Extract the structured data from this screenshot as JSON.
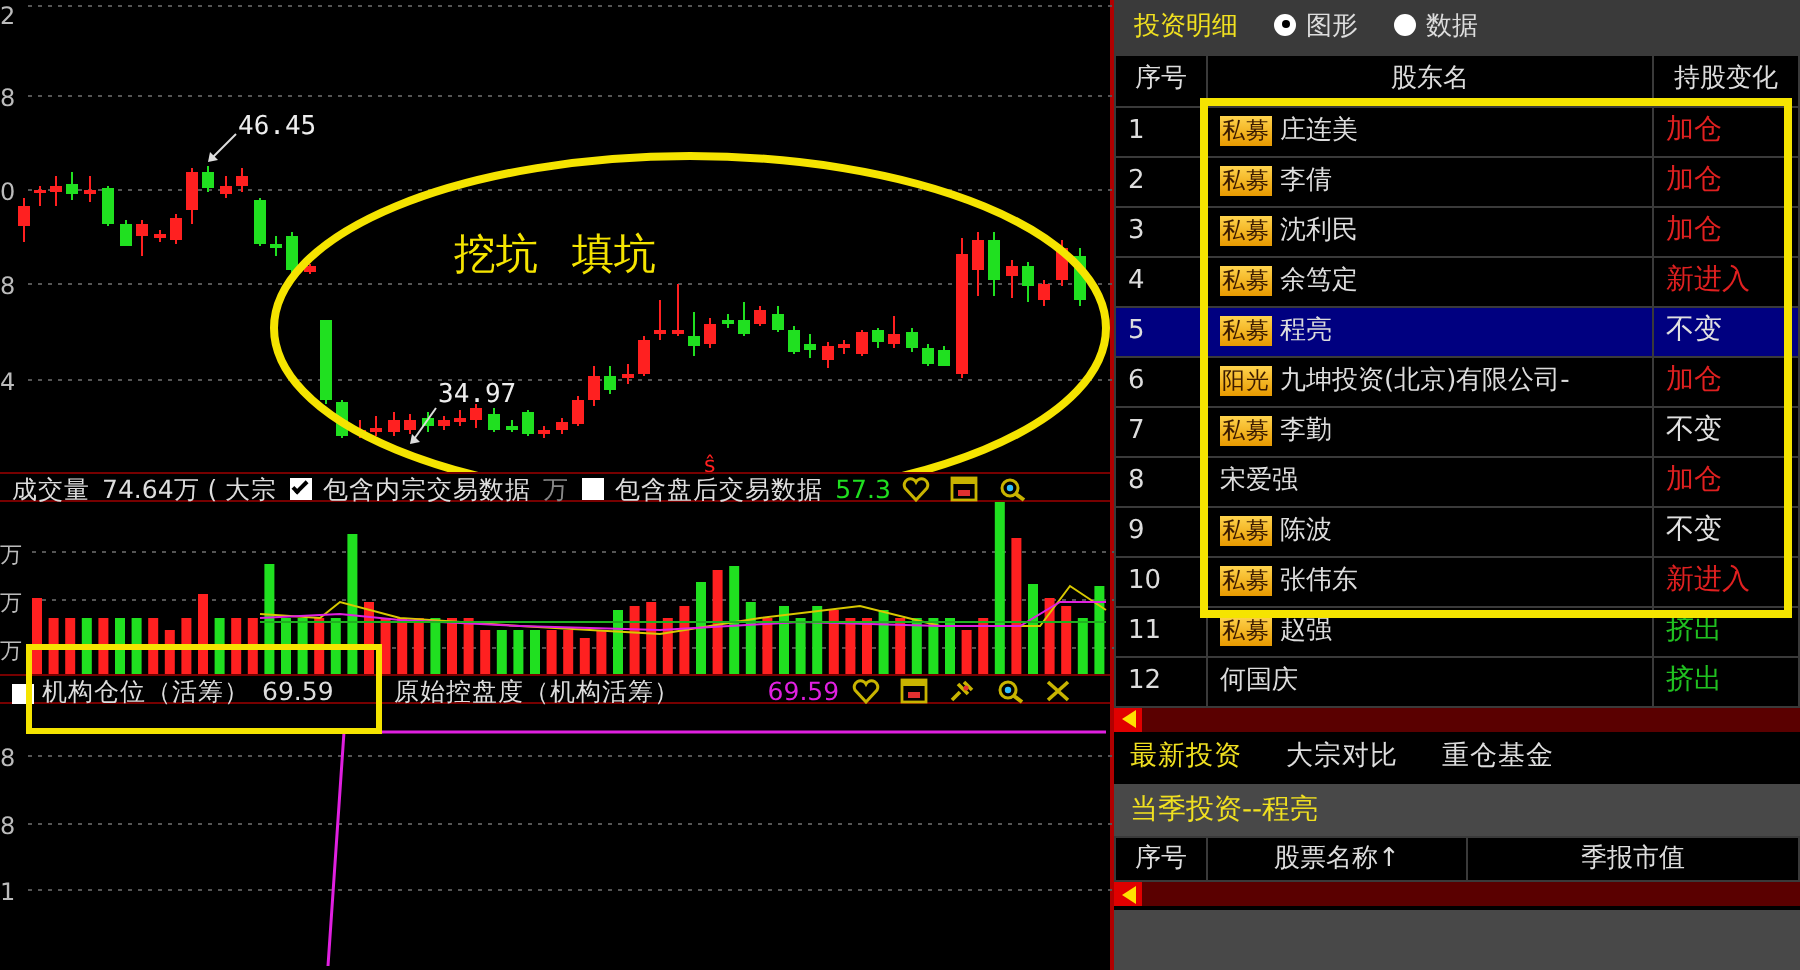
{
  "price_chart": {
    "axis_labels": [
      "2",
      "8",
      "0",
      "8",
      "4"
    ],
    "high_label": "46.45",
    "low_label": "34.97",
    "annotation": [
      "挖坑",
      "填坑"
    ],
    "signal_mark": "ŝ"
  },
  "volume_panel": {
    "title": "成交量",
    "value": "74.64万 ( 大宗",
    "options": [
      {
        "label": "包含内宗交易数据",
        "checked": true
      },
      {
        "label": "包含盘后交易数据",
        "checked": false
      }
    ],
    "suffix": "万",
    "reading": "57.3",
    "axis_labels": [
      "万",
      "万",
      "万"
    ]
  },
  "indicator_panel": {
    "name": "机构仓位（活筹）",
    "value": "69.59",
    "formula": "原始控盘度（机构活筹）",
    "reading": "69.59",
    "axis_labels": [
      "8",
      "8",
      "1"
    ]
  },
  "detail_panel": {
    "title": "投资明细",
    "view_options": [
      {
        "label": "图形",
        "selected": true
      },
      {
        "label": "数据",
        "selected": false
      }
    ],
    "columns": [
      "序号",
      "股东名",
      "持股变化"
    ],
    "rows": [
      {
        "index": "1",
        "badge": "私募",
        "name": "庄连美",
        "change": "加仓",
        "color": "#e02020",
        "selected": false
      },
      {
        "index": "2",
        "badge": "私募",
        "name": "李倩",
        "change": "加仓",
        "color": "#e02020",
        "selected": false
      },
      {
        "index": "3",
        "badge": "私募",
        "name": "沈利民",
        "change": "加仓",
        "color": "#e02020",
        "selected": false
      },
      {
        "index": "4",
        "badge": "私募",
        "name": "余笃定",
        "change": "新进入",
        "color": "#e02020",
        "selected": false
      },
      {
        "index": "5",
        "badge": "私募",
        "name": "程亮",
        "change": "不变",
        "color": "#e0e0e0",
        "selected": true
      },
      {
        "index": "6",
        "badge": "阳光",
        "name": "九坤投资(北京)有限公司-",
        "change": "加仓",
        "color": "#e02020",
        "selected": false
      },
      {
        "index": "7",
        "badge": "私募",
        "name": "李勤",
        "change": "不变",
        "color": "#e0e0e0",
        "selected": false
      },
      {
        "index": "8",
        "name": "宋爱强",
        "change": "加仓",
        "color": "#e02020",
        "selected": false
      },
      {
        "index": "9",
        "badge": "私募",
        "name": "陈波",
        "change": "不变",
        "color": "#e0e0e0",
        "selected": false
      },
      {
        "index": "10",
        "badge": "私募",
        "name": "张伟东",
        "change": "新进入",
        "color": "#e02020",
        "selected": false
      },
      {
        "index": "11",
        "badge": "私募",
        "name": "赵强",
        "change": "挤出",
        "color": "#20c020",
        "selected": false
      },
      {
        "index": "12",
        "name": "何国庆",
        "change": "挤出",
        "color": "#20c020",
        "selected": false
      }
    ]
  },
  "tabs": [
    {
      "label": "最新投资",
      "selected": true
    },
    {
      "label": "大宗对比",
      "selected": false
    },
    {
      "label": "重仓基金",
      "selected": false
    }
  ],
  "section": {
    "title": "当季投资--程亮",
    "columns": [
      "序号",
      "股票名称↑",
      "季报市值"
    ]
  }
}
